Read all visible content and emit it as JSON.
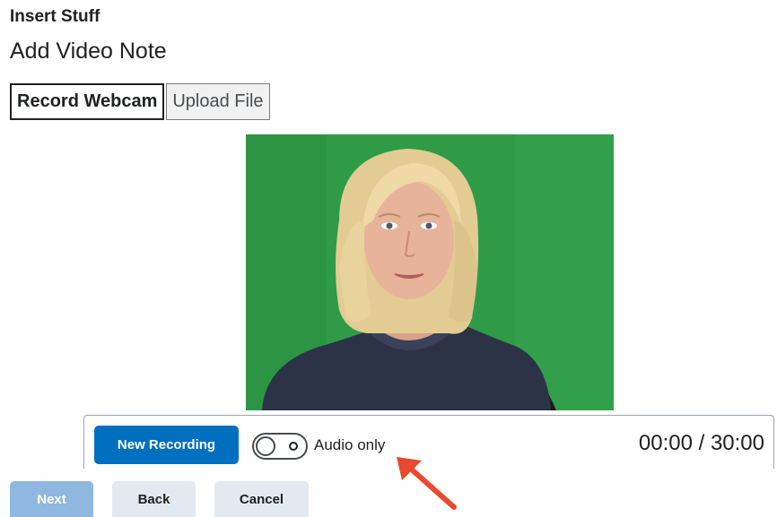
{
  "dialog": {
    "crumb": "Insert Stuff",
    "title": "Add Video Note"
  },
  "tabs": [
    {
      "label": "Record Webcam",
      "selected": true
    },
    {
      "label": "Upload File",
      "selected": false
    }
  ],
  "video": {
    "background_color": "#2e9a45"
  },
  "recorder": {
    "new_recording_label": "New Recording",
    "audio_only_label": "Audio only",
    "audio_only_enabled": false,
    "timer": "00:00 / 30:00"
  },
  "footer": {
    "next_label": "Next",
    "back_label": "Back",
    "cancel_label": "Cancel"
  },
  "colors": {
    "primary": "#006fbf",
    "primary_disabled": "#8fb7df",
    "secondary": "#e3e9f1",
    "annotation_arrow": "#e8492f"
  }
}
